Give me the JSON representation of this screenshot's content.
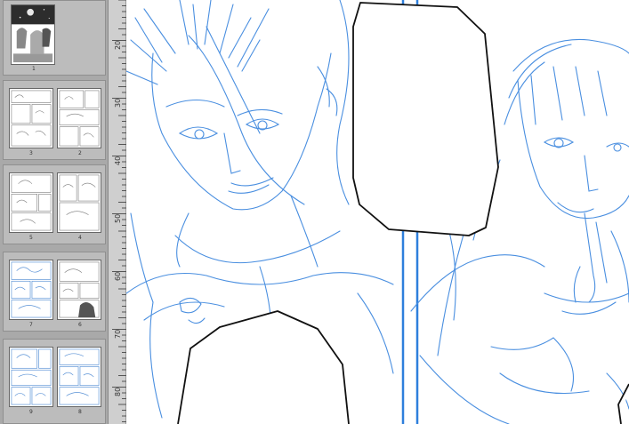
{
  "pages_panel": {
    "groups": [
      {
        "pages": [
          {
            "label": "1",
            "style": "dark"
          }
        ]
      },
      {
        "pages": [
          {
            "label": "3",
            "style": "gray"
          },
          {
            "label": "2",
            "style": "gray"
          }
        ]
      },
      {
        "pages": [
          {
            "label": "5",
            "style": "gray"
          },
          {
            "label": "4",
            "style": "gray"
          }
        ]
      },
      {
        "pages": [
          {
            "label": "7",
            "style": "blue"
          },
          {
            "label": "6",
            "style": "gray"
          }
        ]
      },
      {
        "pages": [
          {
            "label": "9",
            "style": "blue"
          },
          {
            "label": "8",
            "style": "blue"
          }
        ]
      }
    ]
  },
  "ruler": {
    "labels": [
      "20",
      "30",
      "40",
      "50",
      "60",
      "70",
      "80"
    ]
  },
  "canvas": {
    "line_color": "#4a8fe0",
    "border_color": "#2e7fdc"
  }
}
